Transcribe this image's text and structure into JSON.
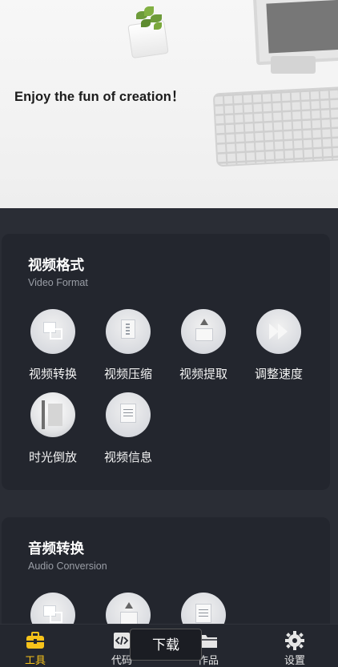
{
  "banner": {
    "tagline": "Enjoy the fun of creation！"
  },
  "sections": [
    {
      "title": "视频格式",
      "subtitle": "Video Format",
      "tools": [
        {
          "label": "视频转换",
          "icon": "video-convert-icon"
        },
        {
          "label": "视频压缩",
          "icon": "video-compress-icon"
        },
        {
          "label": "视频提取",
          "icon": "video-extract-icon"
        },
        {
          "label": "调整速度",
          "icon": "speed-adjust-icon"
        },
        {
          "label": "时光倒放",
          "icon": "reverse-play-icon"
        },
        {
          "label": "视频信息",
          "icon": "video-info-icon"
        }
      ]
    },
    {
      "title": "音频转换",
      "subtitle": "Audio Conversion",
      "tools": [
        {
          "label": "",
          "icon": "audio-convert-icon"
        },
        {
          "label": "",
          "icon": "audio-upload-icon"
        },
        {
          "label": "",
          "icon": "audio-document-icon"
        }
      ]
    }
  ],
  "bottom_nav": {
    "items": [
      {
        "label": "工具",
        "icon": "toolbox-icon",
        "active": true
      },
      {
        "label": "代码",
        "icon": "code-icon",
        "active": false
      },
      {
        "label": "作品",
        "icon": "folder-icon",
        "active": false
      },
      {
        "label": "设置",
        "icon": "gear-icon",
        "active": false
      }
    ]
  },
  "overlay": {
    "download_label": "下载"
  },
  "colors": {
    "accent": "#f7c31a",
    "background": "#2a2d35",
    "card": "#23262e"
  }
}
